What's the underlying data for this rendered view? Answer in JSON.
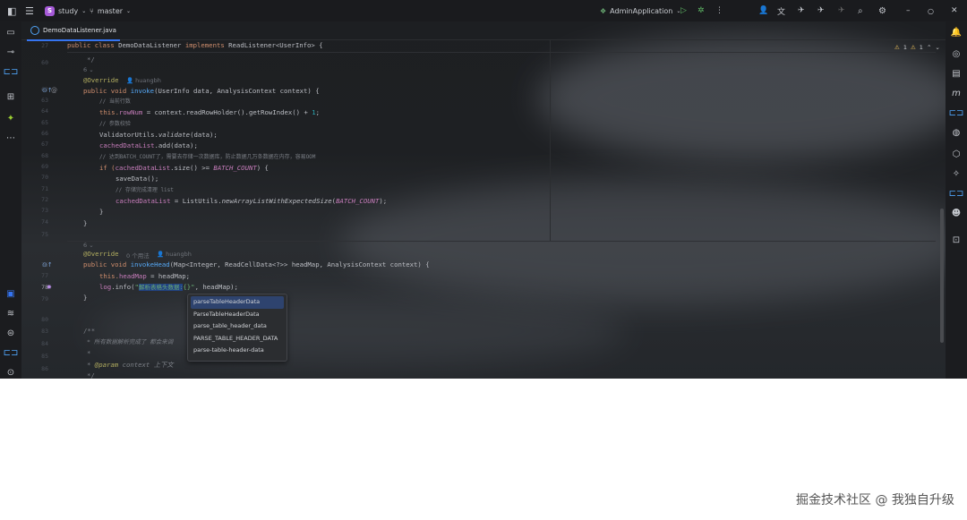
{
  "titlebar": {
    "project_badge": "S",
    "project_name": "study",
    "branch": "master",
    "run_config": "AdminApplication"
  },
  "tab": {
    "file_name": "DemoDataListener.java"
  },
  "inspections": {
    "warn1": "1",
    "warn2": "1"
  },
  "gutter": {
    "lines": [
      "27",
      "60",
      "",
      "",
      "62",
      "63",
      "64",
      "65",
      "66",
      "67",
      "68",
      "69",
      "70",
      "71",
      "72",
      "73",
      "74",
      "75",
      "",
      "76",
      "77",
      "78",
      "79",
      "80",
      "81",
      "",
      "83",
      "84",
      "85",
      "86",
      "87"
    ]
  },
  "hints": {
    "author1": "huangbh",
    "usages": "0 个用法",
    "author2": "huangbh",
    "foldhint": "6 ⌄"
  },
  "code": {
    "l_class": [
      "public class ",
      "DemoDataListener ",
      "implements ",
      "ReadListener<UserInfo> {"
    ],
    "l_close_comment": "*/",
    "l_ann1": "@Override",
    "l_invoke": [
      "public void ",
      "invoke",
      "(UserInfo data, AnalysisContext context) {"
    ],
    "l_c1": "// 当前行数",
    "l_rownum": [
      "this.",
      "rowNum",
      " = context.readRowHolder().getRowIndex() + ",
      "1",
      ";"
    ],
    "l_c2": "// 参数校验",
    "l_validate": [
      "ValidatorUtils.",
      "validate",
      "(data);"
    ],
    "l_add": [
      "cachedDataList",
      ".add(data);"
    ],
    "l_c3": "// 达到BATCH_COUNT了，需要去存储一次数据库，防止数据几万条数据在内存，容易OOM",
    "l_if": [
      "if (",
      "cachedDataList",
      ".size() >= ",
      "BATCH_COUNT",
      ") {"
    ],
    "l_save": "saveData();",
    "l_c4": "// 存储完成清理 list",
    "l_reset": [
      "cachedDataList",
      " = ListUtils.",
      "newArrayListWithExpectedSize",
      "(",
      "BATCH_COUNT",
      ");"
    ],
    "l_brace1": "}",
    "l_brace2": "}",
    "l_ann2": "@Override",
    "l_head": [
      "public void ",
      "invokeHead",
      "(Map<Integer, ReadCellData<?>> headMap, AnalysisContext context) {"
    ],
    "l_headmap": [
      "this.",
      "headMap",
      " = headMap;"
    ],
    "l_log": [
      "log",
      ".info(",
      "\"",
      "解析表格头数据:",
      "{}\"",
      ", headMap);"
    ],
    "l_brace3": "}",
    "l_doc1": "/**",
    "l_doc2": "* 所有数据解析完成了 都会来调",
    "l_doc3": "*",
    "l_doc4": [
      "* ",
      "@param ",
      "context",
      " 上下文"
    ],
    "l_doc5": "*/"
  },
  "popup": {
    "items": [
      "parseTableHeaderData",
      "ParseTableHeaderData",
      "parse_table_header_data",
      "PARSE_TABLE_HEADER_DATA",
      "parse-table-header-data"
    ]
  },
  "watermark": "掘金技术社区 @ 我独自升级"
}
